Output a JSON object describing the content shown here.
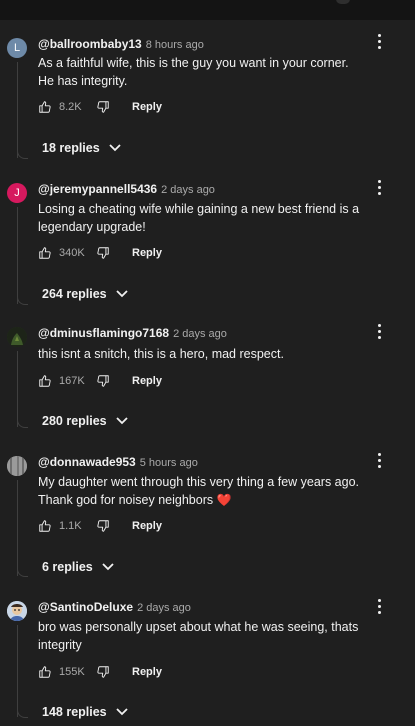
{
  "comments": [
    {
      "author": "@ballroombaby13",
      "time": "8 hours ago",
      "avatar_letter": "L",
      "avatar_color": "#6e8aa8",
      "text": "As a faithful wife, this is the guy you want in your corner. He has integrity.",
      "likes": "8.2K",
      "reply_label": "Reply",
      "replies_label": "18 replies"
    },
    {
      "author": "@jeremypannell5436",
      "time": "2 days ago",
      "avatar_letter": "J",
      "avatar_color": "#d6195e",
      "text": "Losing a cheating wife while gaining a new best friend is a legendary upgrade!",
      "likes": "340K",
      "reply_label": "Reply",
      "replies_label": "264 replies"
    },
    {
      "author": "@dminusflamingo7168",
      "time": "2 days ago",
      "avatar_color": "#2d3a24",
      "text": "this isnt a snitch, this is a hero, mad respect.",
      "likes": "167K",
      "reply_label": "Reply",
      "replies_label": "280 replies"
    },
    {
      "author": "@donnawade953",
      "time": "5 hours ago",
      "avatar_color": "#8c8c8c",
      "text": "My daughter went through this very thing a few years ago. Thank god for noisey neighbors",
      "emoji": "❤️",
      "likes": "1.1K",
      "reply_label": "Reply",
      "replies_label": "6 replies"
    },
    {
      "author": "@SantinoDeluxe",
      "time": "2 days ago",
      "avatar_color": "#b9c7d8",
      "text": "bro was personally upset about what he was seeing, thats integrity",
      "likes": "155K",
      "reply_label": "Reply",
      "replies_label": "148 replies"
    }
  ]
}
